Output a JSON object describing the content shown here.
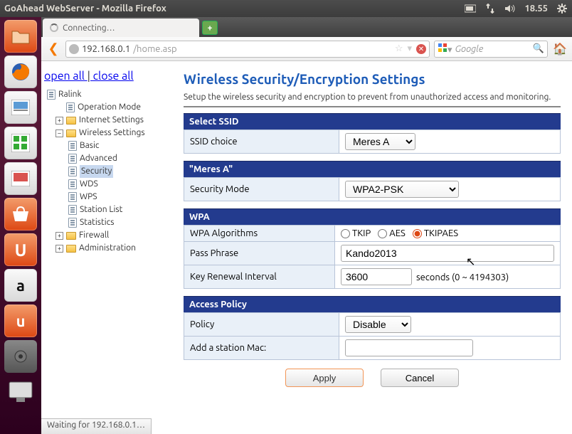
{
  "top_panel": {
    "window_title": "GoAhead WebServer - Mozilla Firefox",
    "time": "18.55"
  },
  "browser": {
    "tab_title": "Connecting…",
    "url_host": "192.168.0.1",
    "url_path": "/home.asp",
    "search_placeholder": "Google",
    "status_text": "Waiting for 192.168.0.1…"
  },
  "sidebar": {
    "open_all": "open all",
    "close_all": "close all",
    "root": "Ralink",
    "nodes": {
      "operation_mode": "Operation Mode",
      "internet_settings": "Internet Settings",
      "wireless_settings": "Wireless Settings",
      "basic": "Basic",
      "advanced": "Advanced",
      "security": "Security",
      "wds": "WDS",
      "wps": "WPS",
      "station_list": "Station List",
      "statistics": "Statistics",
      "firewall": "Firewall",
      "administration": "Administration"
    }
  },
  "page": {
    "title": "Wireless Security/Encryption Settings",
    "desc": "Setup the wireless security and encryption to prevent from unauthorized access and monitoring.",
    "section_select_ssid": "Select SSID",
    "ssid_choice_label": "SSID choice",
    "ssid_choice_value": "Meres A",
    "section_ssid_name": "\"Meres A\"",
    "security_mode_label": "Security Mode",
    "security_mode_value": "WPA2-PSK",
    "section_wpa": "WPA",
    "wpa_algorithms_label": "WPA Algorithms",
    "algo_tkip": "TKIP",
    "algo_aes": "AES",
    "algo_tkipaes": "TKIPAES",
    "pass_phrase_label": "Pass Phrase",
    "pass_phrase_value": "Kando2013",
    "key_renewal_label": "Key Renewal Interval",
    "key_renewal_value": "3600",
    "key_renewal_suffix": "seconds   (0 ~ 4194303)",
    "section_access_policy": "Access Policy",
    "policy_label": "Policy",
    "policy_value": "Disable",
    "add_mac_label": "Add a station Mac:",
    "apply": "Apply",
    "cancel": "Cancel"
  }
}
